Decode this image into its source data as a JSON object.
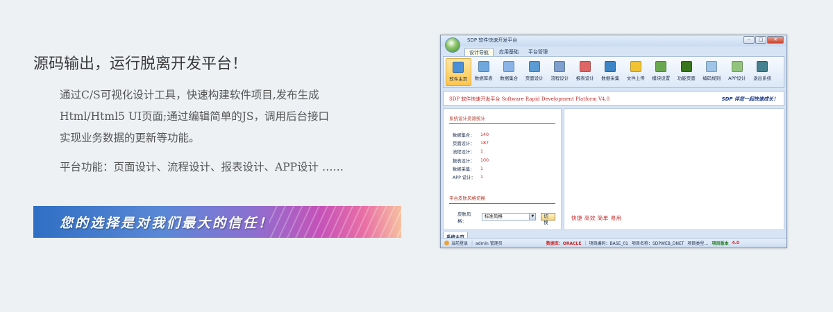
{
  "headline": "源码输出，运行脱离开发平台！",
  "description_lines": [
    "通过C/S可视化设计工具，快速构建软件项目,发布生成",
    "Html/Html5 UI页面;通过编辑简单的JS，调用后台接口",
    "实现业务数据的更新等功能。"
  ],
  "features": "平台功能：页面设计、流程设计、报表设计、APP设计 ……",
  "banner": "您的选择是对我们最大的信任！",
  "window": {
    "title": "SDP 软件快速开发平台",
    "controls": [
      "minimize",
      "maximize",
      "close"
    ],
    "tabs": [
      "设计导航",
      "应用基础",
      "平台管理"
    ],
    "ribbon": [
      {
        "label": "软件主页",
        "icon": "home-icon",
        "color": "#4a90d9"
      },
      {
        "label": "数据库表",
        "icon": "database-table-icon",
        "color": "#6fa8dc"
      },
      {
        "label": "数据集合",
        "icon": "dataset-icon",
        "color": "#8ab4e8"
      },
      {
        "label": "页面设计",
        "icon": "page-design-icon",
        "color": "#5b9bd5"
      },
      {
        "label": "流程设计",
        "icon": "flow-icon",
        "color": "#7f9fcf"
      },
      {
        "label": "报表设计",
        "icon": "report-chart-icon",
        "color": "#e06666"
      },
      {
        "label": "数据采集",
        "icon": "data-collect-icon",
        "color": "#3d85c6"
      },
      {
        "label": "文件上传",
        "icon": "file-upload-icon",
        "color": "#f1c232"
      },
      {
        "label": "模块设置",
        "icon": "module-settings-icon",
        "color": "#6aa84f"
      },
      {
        "label": "功能页面",
        "icon": "function-page-icon",
        "color": "#38761d"
      },
      {
        "label": "编码规则",
        "icon": "code-rule-icon",
        "color": "#9fc5e8"
      },
      {
        "label": "APP设计",
        "icon": "android-icon",
        "color": "#93c47d"
      },
      {
        "label": "退出系统",
        "icon": "exit-icon",
        "color": "#45818e"
      }
    ],
    "header_left": "SDP 软件快速开发平台 Software Rapid Development Platform V4.0",
    "header_right": "SDP 伴您一起快速成长！",
    "stats_title": "系统设计资源统计",
    "stats": [
      {
        "label": "数据集合：",
        "value": "140"
      },
      {
        "label": "页面设计：",
        "value": "187"
      },
      {
        "label": "流程设计：",
        "value": "1"
      },
      {
        "label": "报表设计：",
        "value": "100"
      },
      {
        "label": "数据采集：",
        "value": "1"
      },
      {
        "label": "APP 设计：",
        "value": "1"
      }
    ],
    "skin_title": "平台皮肤风格切换",
    "skin_label": "皮肤风格：",
    "skin_value": "标准风格",
    "skin_button": "切换",
    "slogan": "快捷 高效 简单 易用",
    "bottom_tab": "系统主页",
    "status": {
      "login": "当前登录",
      "user": "admin 管理员",
      "db_label": "数据库：ORACLE",
      "project_code": "项目编码：BASE_01",
      "project_name": "项目名称：SDPWEB_DNET",
      "project_type": "项目类型…",
      "version_label": "项目版本",
      "version": "4.0"
    }
  }
}
